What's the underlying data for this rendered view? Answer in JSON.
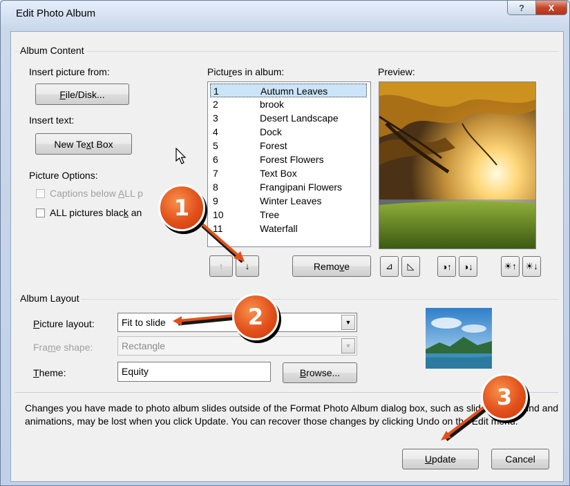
{
  "window": {
    "title": "Edit Photo Album",
    "help_glyph": "?",
    "close_glyph": "X"
  },
  "album_content": {
    "group_label": "Album Content",
    "insert_picture_label": "Insert picture from:",
    "file_disk_button": {
      "pre": "",
      "mnemonic": "F",
      "post": "ile/Disk..."
    },
    "insert_text_label": "Insert text:",
    "new_text_box_button": {
      "pre": "New Te",
      "mnemonic": "x",
      "post": "t Box"
    },
    "picture_options_label": "Picture Options:",
    "captions_checkbox": {
      "pre": "Captions below ",
      "mnemonic": "A",
      "post": "LL p",
      "checked": false,
      "disabled": true
    },
    "black_white_checkbox": {
      "pre": "ALL pictures blac",
      "mnemonic": "k",
      "post": " an",
      "checked": false,
      "disabled": false
    },
    "pictures_label": {
      "pre": "Pictu",
      "mnemonic": "r",
      "post": "es in album:"
    },
    "pictures": [
      {
        "num": "1",
        "name": "Autumn Leaves",
        "selected": true
      },
      {
        "num": "2",
        "name": "brook",
        "selected": false
      },
      {
        "num": "3",
        "name": "Desert Landscape",
        "selected": false
      },
      {
        "num": "4",
        "name": "Dock",
        "selected": false
      },
      {
        "num": "5",
        "name": "Forest",
        "selected": false
      },
      {
        "num": "6",
        "name": "Forest Flowers",
        "selected": false
      },
      {
        "num": "7",
        "name": "Text Box",
        "selected": false
      },
      {
        "num": "8",
        "name": "Frangipani Flowers",
        "selected": false
      },
      {
        "num": "9",
        "name": "Winter Leaves",
        "selected": false
      },
      {
        "num": "10",
        "name": "Tree",
        "selected": false
      },
      {
        "num": "11",
        "name": "Waterfall",
        "selected": false
      }
    ],
    "move_up_glyph": "↑",
    "move_down_glyph": "↓",
    "remove_button": {
      "pre": "Remo",
      "mnemonic": "v",
      "post": "e"
    },
    "preview_label": "Preview:",
    "preview_image": "autumn-tree-sunset-photo",
    "image_tools": [
      {
        "name": "rotate-left-icon",
        "glyph": "⊿"
      },
      {
        "name": "rotate-right-icon",
        "glyph": "◺"
      },
      {
        "name": "contrast-up-icon",
        "glyph": "◑↑"
      },
      {
        "name": "contrast-down-icon",
        "glyph": "◑↓"
      },
      {
        "name": "brightness-up-icon",
        "glyph": "☀↑"
      },
      {
        "name": "brightness-down-icon",
        "glyph": "☀↓"
      }
    ]
  },
  "album_layout": {
    "group_label": "Album Layout",
    "picture_layout_label": {
      "pre": "",
      "mnemonic": "P",
      "post": "icture layout:"
    },
    "picture_layout_value": "Fit to slide",
    "frame_shape_label": {
      "pre": "Fra",
      "mnemonic": "m",
      "post": "e shape:"
    },
    "frame_shape_value": "Rectangle",
    "theme_label": {
      "pre": "",
      "mnemonic": "T",
      "post": "heme:"
    },
    "theme_value": "Equity",
    "browse_button": {
      "pre": "",
      "mnemonic": "B",
      "post": "rowse..."
    },
    "layout_preview_image": "mountain-lake-thumbnail"
  },
  "footer": {
    "message": "Changes you have made to photo album slides outside of the Format Photo Album dialog box, such as slide background and animations, may be lost when you click Update. You can recover those changes by clicking Undo on the Edit menu.",
    "update_button": {
      "pre": "",
      "mnemonic": "U",
      "post": "pdate"
    },
    "cancel_button": "Cancel"
  },
  "callouts": [
    "1",
    "2",
    "3"
  ],
  "colors": {
    "callout": "#e2501a",
    "selection": "#cce4f7",
    "arrow": "#e2501a"
  }
}
